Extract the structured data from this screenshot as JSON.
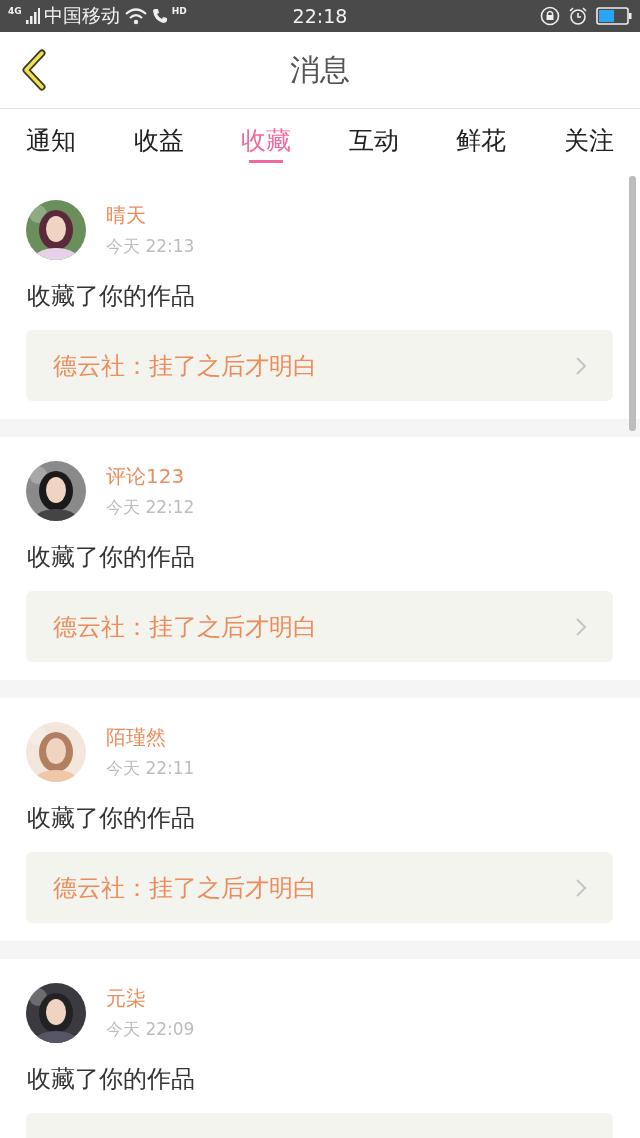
{
  "status_bar": {
    "network": "4G",
    "carrier": "中国移动",
    "call": "HD",
    "time": "22:18"
  },
  "header": {
    "title": "消息"
  },
  "tabs": [
    {
      "label": "通知",
      "selected": false
    },
    {
      "label": "收益",
      "selected": false
    },
    {
      "label": "收藏",
      "selected": true
    },
    {
      "label": "互动",
      "selected": false
    },
    {
      "label": "鲜花",
      "selected": false
    },
    {
      "label": "关注",
      "selected": false
    }
  ],
  "items": [
    {
      "name": "晴天",
      "time": "今天 22:13",
      "action": "收藏了你的作品",
      "work": "德云社：挂了之后才明白"
    },
    {
      "name": "评论123",
      "time": "今天 22:12",
      "action": "收藏了你的作品",
      "work": "德云社：挂了之后才明白"
    },
    {
      "name": "陌瑾然",
      "time": "今天 22:11",
      "action": "收藏了你的作品",
      "work": "德云社：挂了之后才明白"
    },
    {
      "name": "元柒",
      "time": "今天 22:09",
      "action": "收藏了你的作品"
    }
  ]
}
